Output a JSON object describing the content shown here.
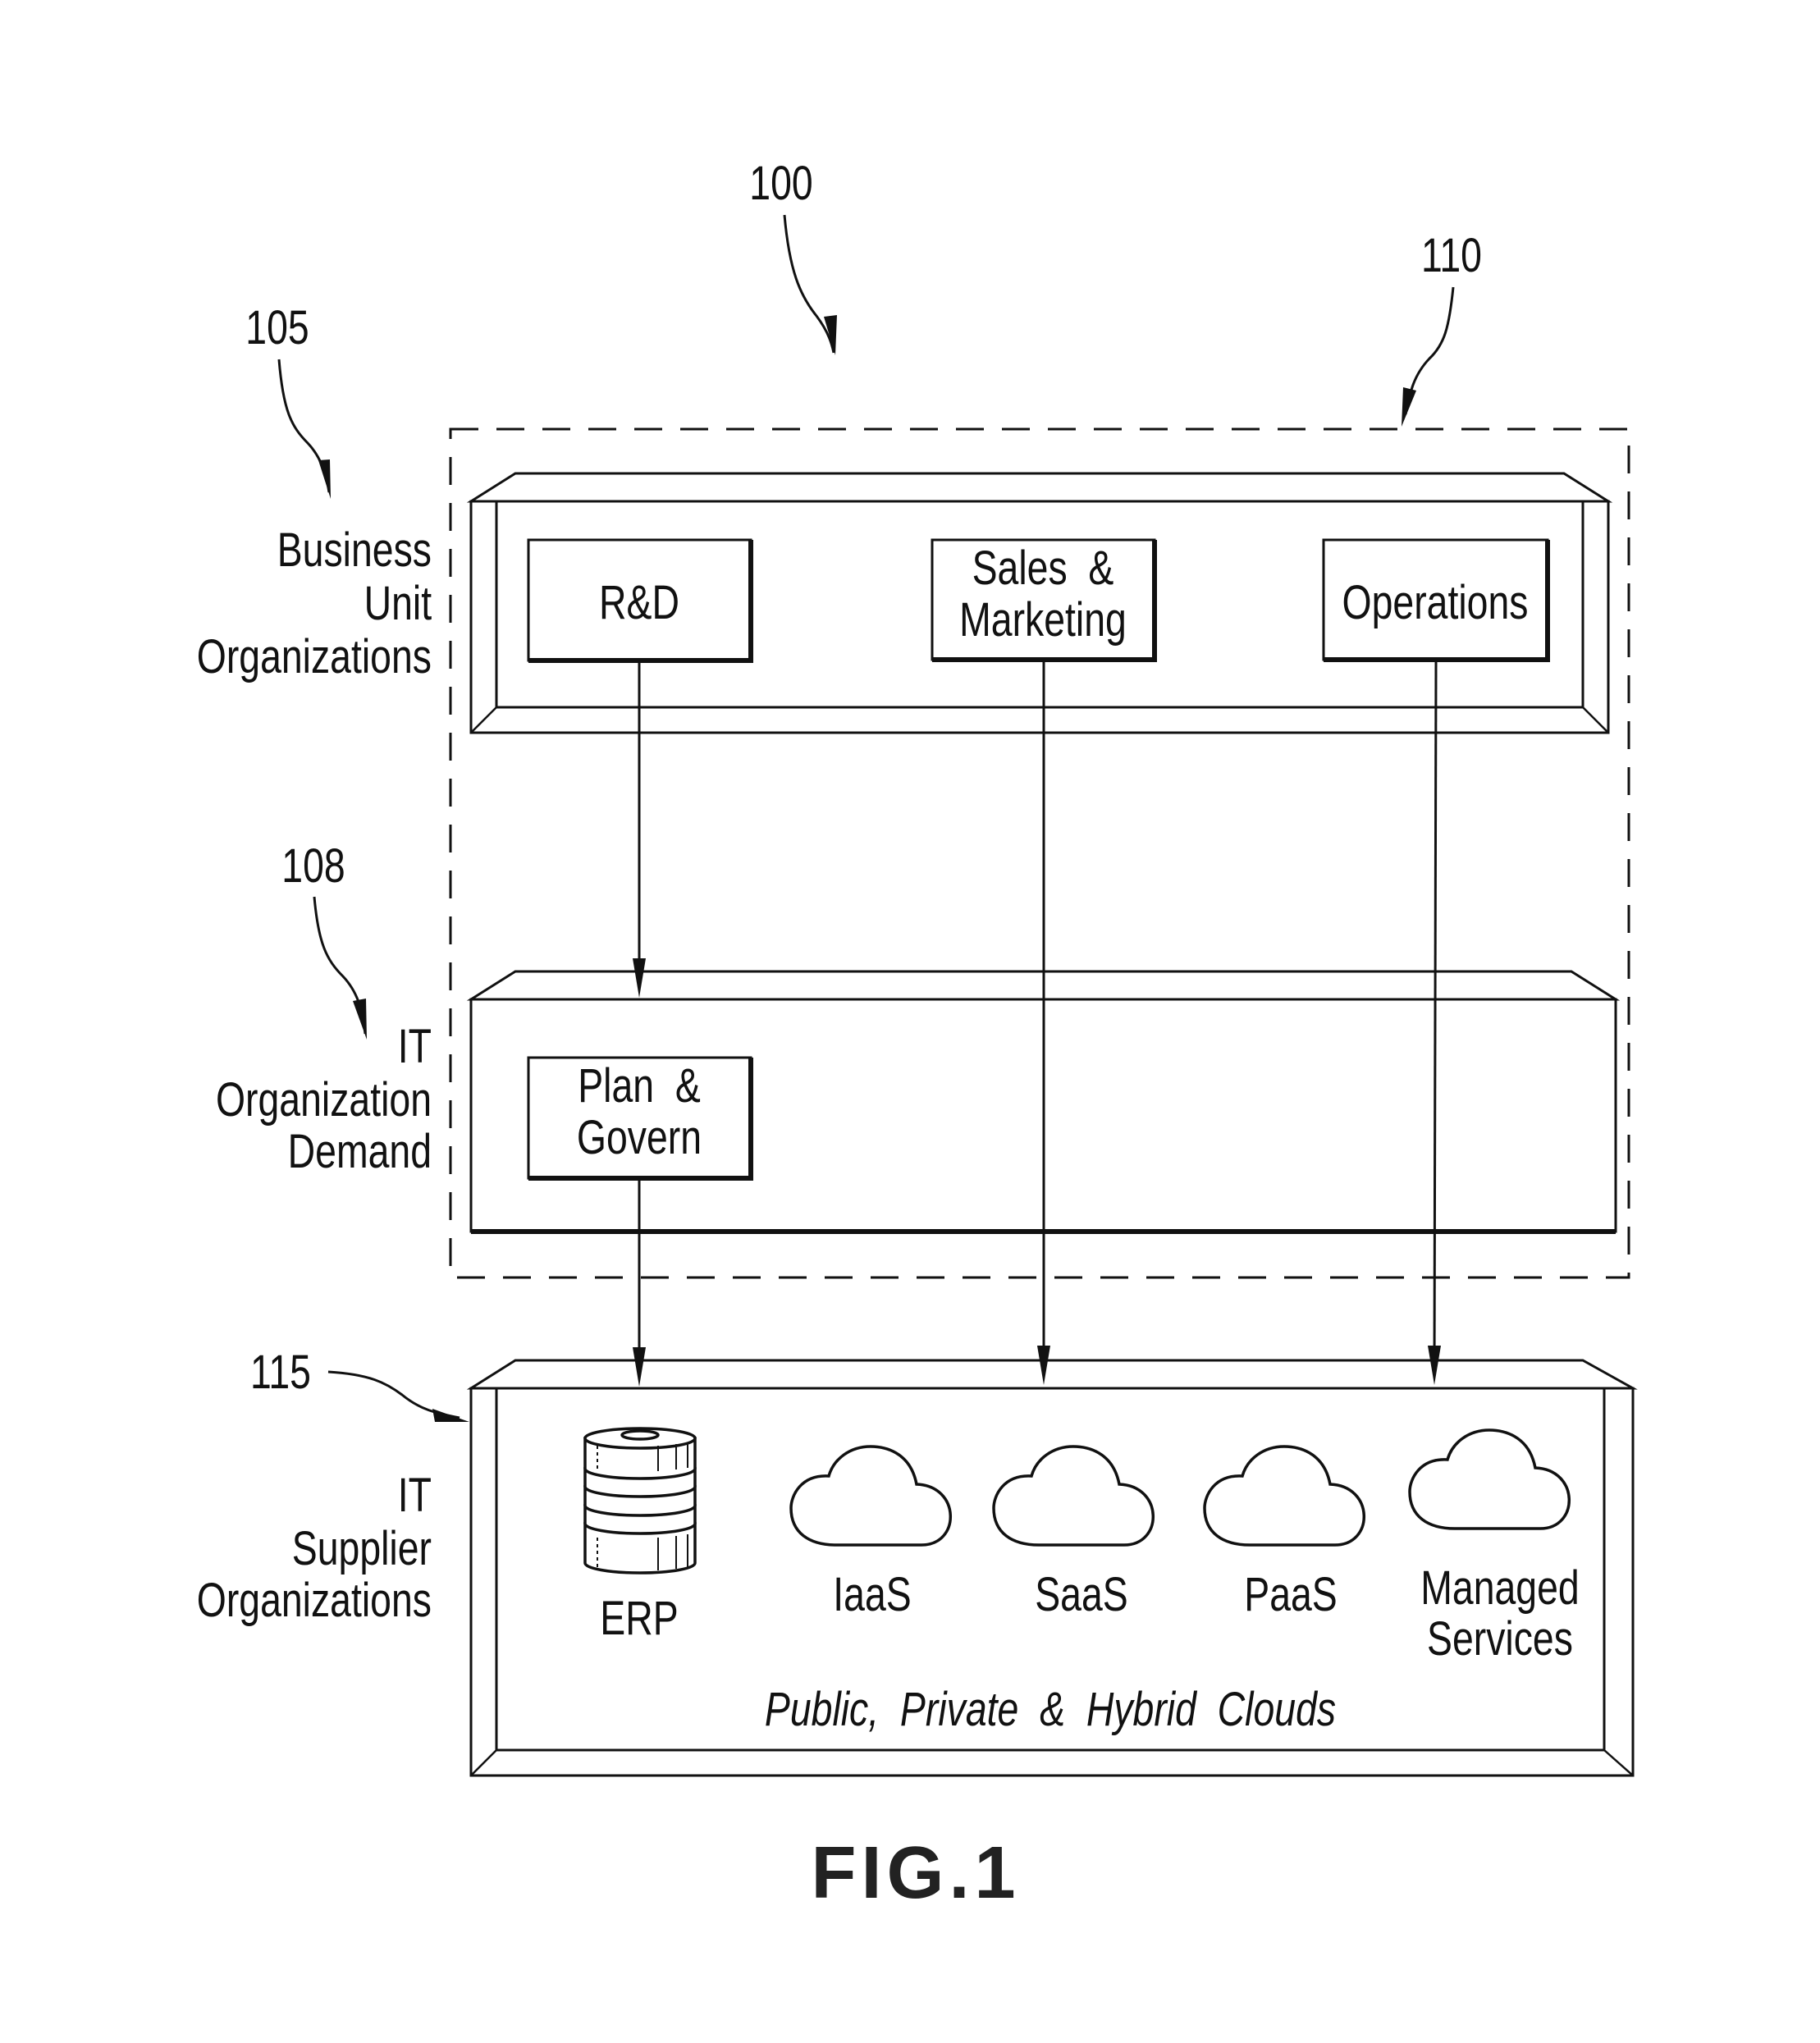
{
  "figure": {
    "caption": "FIG.1",
    "reference_numerals": {
      "system": "100",
      "business_units": "105",
      "it_demand": "108",
      "enterprise_boundary": "110",
      "it_suppliers": "115"
    },
    "tiers": [
      {
        "id": "business-units",
        "label_lines": [
          "Business",
          "Unit",
          "Organizations"
        ],
        "boxes": [
          {
            "lines": [
              "R&D"
            ]
          },
          {
            "lines": [
              "Sales  &",
              "Marketing"
            ]
          },
          {
            "lines": [
              "Operations"
            ]
          }
        ]
      },
      {
        "id": "it-demand",
        "label_lines": [
          "IT",
          "Organization",
          "Demand"
        ],
        "boxes": [
          {
            "lines": [
              "Plan  &",
              "Govern"
            ]
          }
        ]
      },
      {
        "id": "it-suppliers",
        "label_lines": [
          "IT",
          "Supplier",
          "Organizations"
        ],
        "services": [
          {
            "icon": "database-icon",
            "lines": [
              "ERP"
            ]
          },
          {
            "icon": "cloud-icon",
            "lines": [
              "IaaS"
            ]
          },
          {
            "icon": "cloud-icon",
            "lines": [
              "SaaS"
            ]
          },
          {
            "icon": "cloud-icon",
            "lines": [
              "PaaS"
            ]
          },
          {
            "icon": "cloud-icon",
            "lines": [
              "Managed",
              "Services"
            ]
          }
        ],
        "footer": "Public,  Private  &  Hybrid  Clouds"
      }
    ],
    "connections": [
      {
        "from": "R&D",
        "to": "Plan & Govern"
      },
      {
        "from": "Plan & Govern",
        "to": "ERP"
      },
      {
        "from": "Sales & Marketing",
        "to": "SaaS"
      },
      {
        "from": "Operations",
        "to": "Managed Services"
      }
    ]
  }
}
